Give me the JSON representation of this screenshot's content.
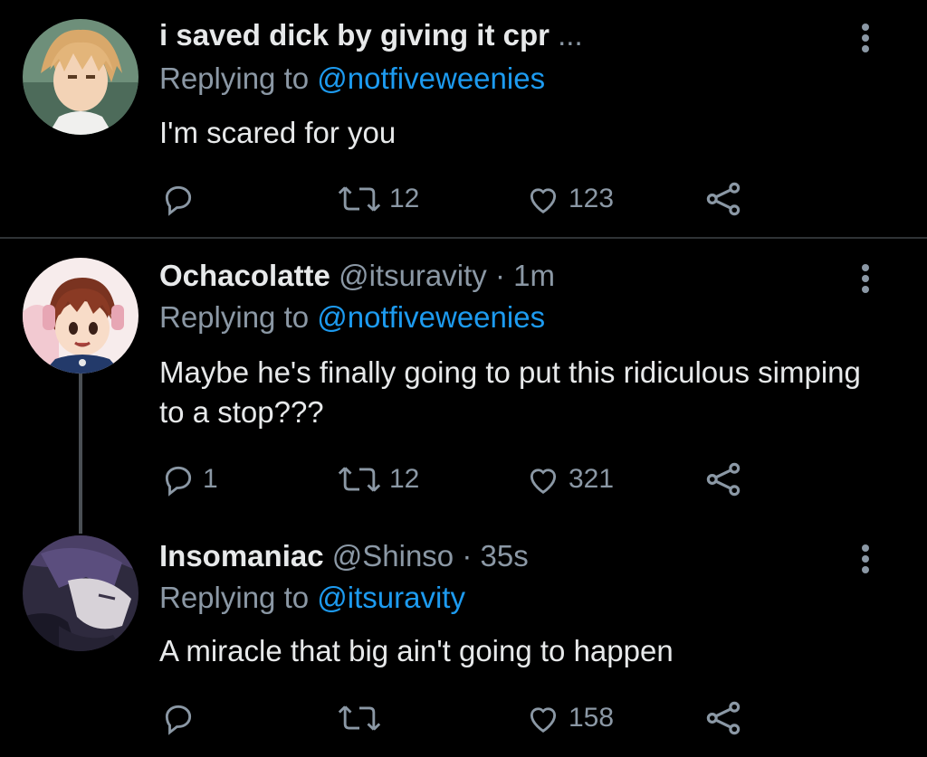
{
  "tweets": [
    {
      "name": "i saved dick by giving it cpr",
      "name_suffix": " ...",
      "handle": "",
      "time": "",
      "replying_prefix": "Replying to ",
      "replying_to": "@notfiveweenies",
      "text": "I'm scared for you",
      "replies": "",
      "retweets": "12",
      "likes": "123"
    },
    {
      "name": "Ochacolatte",
      "handle": "@itsuravity",
      "time": "· 1m",
      "replying_prefix": "Replying to ",
      "replying_to": "@notfiveweenies",
      "text": "Maybe he's finally going to put this ridiculous simping to a stop???",
      "replies": "1",
      "retweets": "12",
      "likes": "321"
    },
    {
      "name": "Insomaniac",
      "handle": "@Shinso",
      "time": "· 35s",
      "replying_prefix": "Replying to ",
      "replying_to": "@itsuravity",
      "text": "A miracle that big ain't going to happen",
      "replies": "",
      "retweets": "",
      "likes": "158"
    }
  ],
  "colors": {
    "background": "#000000",
    "text": "#e7e9ea",
    "secondary": "#8b98a5",
    "link": "#1d9bf0"
  }
}
